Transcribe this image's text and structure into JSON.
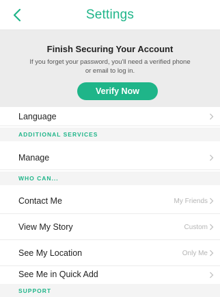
{
  "header": {
    "title": "Settings",
    "back_icon": "chevron-left-icon"
  },
  "banner": {
    "title": "Finish Securing Your Account",
    "text": "If you forget your password, you'll need a verified phone or email to log in.",
    "button_label": "Verify Now"
  },
  "colors": {
    "accent": "#1fb589",
    "banner_bg": "#ececec",
    "section_bg": "#f4f4f4",
    "muted": "#b5b5b5"
  },
  "rows": {
    "language": {
      "label": "Language"
    },
    "manage": {
      "label": "Manage"
    },
    "contact_me": {
      "label": "Contact Me",
      "value": "My Friends"
    },
    "view_my_story": {
      "label": "View My Story",
      "value": "Custom"
    },
    "see_my_location": {
      "label": "See My Location",
      "value": "Only Me"
    },
    "quick_add": {
      "label": "See Me in Quick Add"
    }
  },
  "sections": {
    "additional_services": "ADDITIONAL SERVICES",
    "who_can": "WHO CAN...",
    "support": "SUPPORT"
  }
}
